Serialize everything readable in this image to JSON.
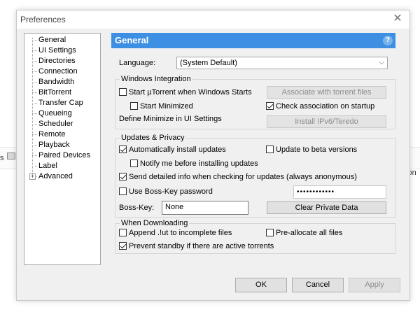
{
  "background": {
    "left_text": "s",
    "right_text": "tion"
  },
  "window": {
    "title": "Preferences",
    "close_symbol": "✕"
  },
  "tree": {
    "items": [
      {
        "label": "General"
      },
      {
        "label": "UI Settings"
      },
      {
        "label": "Directories"
      },
      {
        "label": "Connection"
      },
      {
        "label": "Bandwidth"
      },
      {
        "label": "BitTorrent"
      },
      {
        "label": "Transfer Cap"
      },
      {
        "label": "Queueing"
      },
      {
        "label": "Scheduler"
      },
      {
        "label": "Remote"
      },
      {
        "label": "Playback"
      },
      {
        "label": "Paired Devices"
      },
      {
        "label": "Label"
      },
      {
        "label": "Advanced",
        "expander": "+"
      }
    ]
  },
  "header": {
    "title": "General",
    "help_symbol": "?"
  },
  "language": {
    "label": "Language:",
    "value": "(System Default)",
    "chevron": "⌵"
  },
  "windows_integration": {
    "title": "Windows Integration",
    "start_with_windows": {
      "label": "Start µTorrent when Windows Starts",
      "checked": false
    },
    "start_minimized": {
      "label": "Start Minimized",
      "checked": false
    },
    "define_minimize": "Define Minimize in UI Settings",
    "associate_button": "Associate with torrent files",
    "check_association": {
      "label": "Check association on startup",
      "checked": true
    },
    "install_ipv6_button": "Install IPv6/Teredo"
  },
  "updates_privacy": {
    "title": "Updates & Privacy",
    "auto_install": {
      "label": "Automatically install updates",
      "checked": true
    },
    "beta_versions": {
      "label": "Update to beta versions",
      "checked": false
    },
    "notify_before": {
      "label": "Notify me before installing updates",
      "checked": false
    },
    "send_info": {
      "label": "Send detailed info when checking for updates (always anonymous)",
      "checked": true
    },
    "boss_key_password": {
      "label": "Use Boss-Key password",
      "checked": false
    },
    "password_value": "••••••••••••",
    "boss_key_label": "Boss-Key:",
    "boss_key_value": "None",
    "clear_private_button": "Clear Private Data"
  },
  "when_downloading": {
    "title": "When Downloading",
    "append_ut": {
      "label": "Append .!ut to incomplete files",
      "checked": false
    },
    "preallocate": {
      "label": "Pre-allocate all files",
      "checked": false
    },
    "prevent_standby": {
      "label": "Prevent standby if there are active torrents",
      "checked": true
    }
  },
  "footer": {
    "ok": "OK",
    "cancel": "Cancel",
    "apply": "Apply"
  }
}
